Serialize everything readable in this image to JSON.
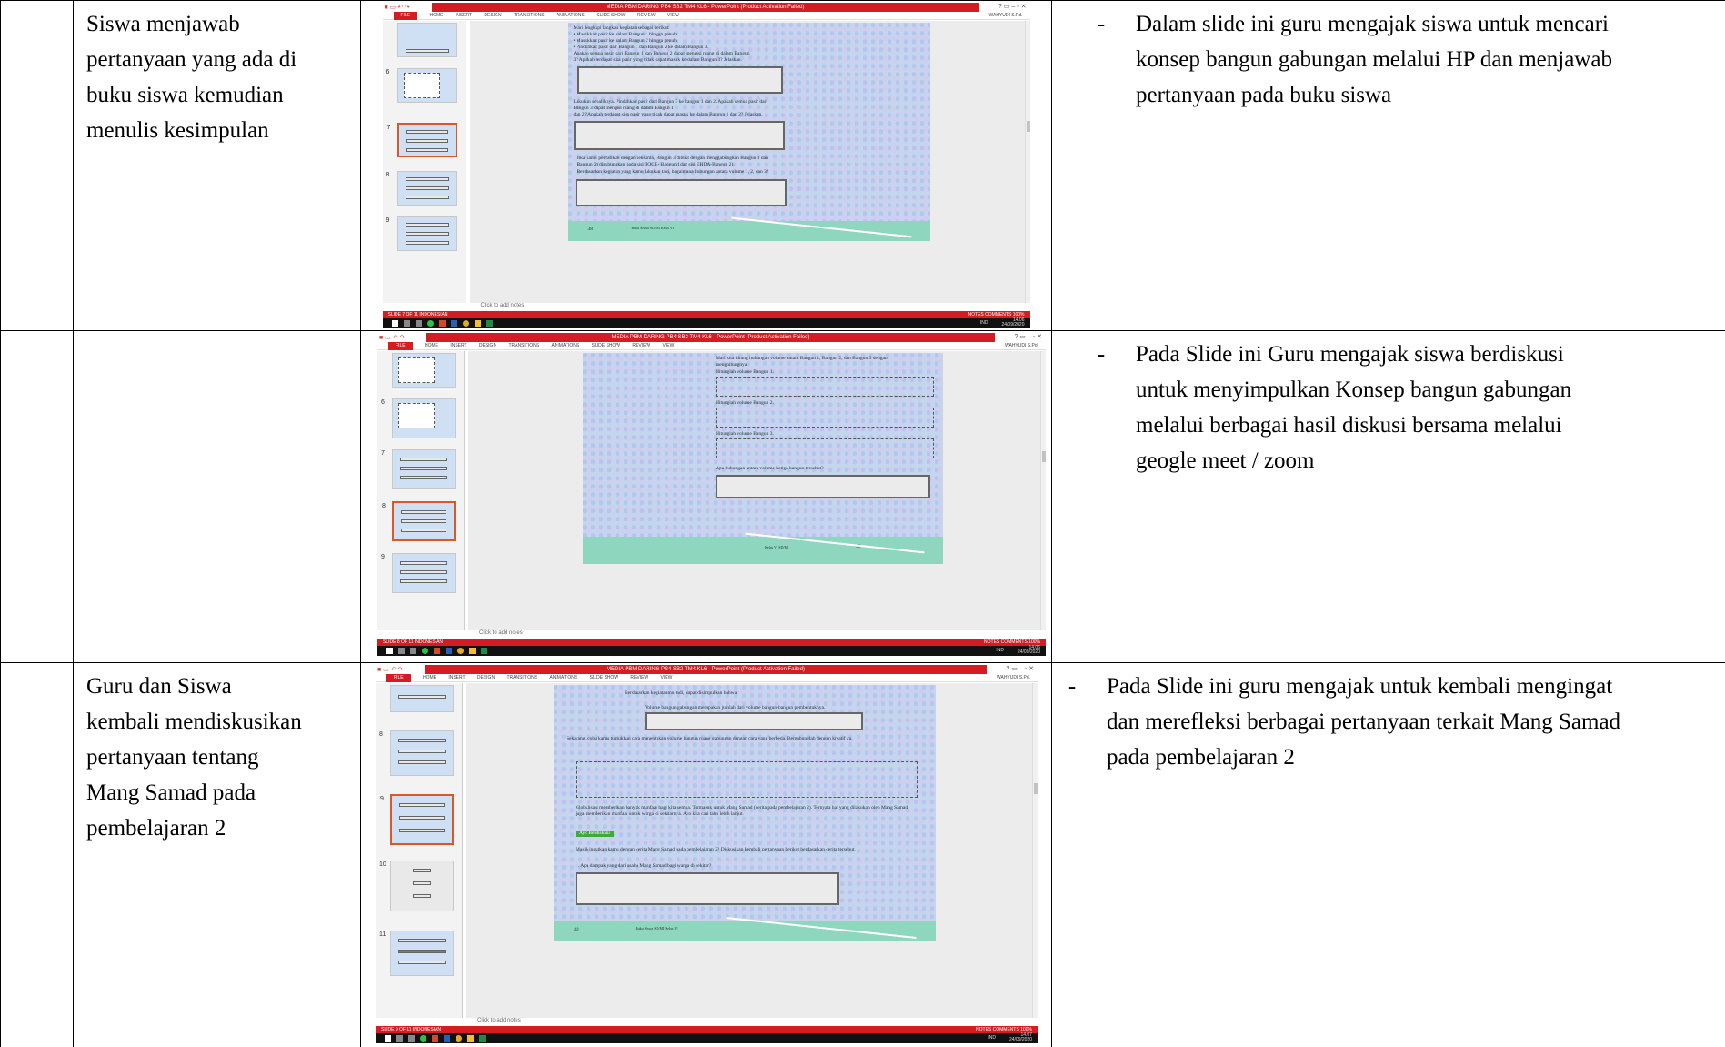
{
  "rows": [
    {
      "activity": "Siswa menjawab pertanyaan yang ada di buku siswa kemudian menulis kesimpulan",
      "activity_lines": [
        "Siswa menjawab",
        "pertanyaan yang ada di",
        "buku siswa kemudian",
        "menulis kesimpulan"
      ],
      "dash": "-",
      "desc_lines": [
        "Dalam slide ini guru mengajak siswa untuk mencari",
        "konsep bangun gabungan melalui HP dan menjawab",
        "pertanyaan pada buku siswa"
      ],
      "shot": {
        "title": "MEDIA PBM DARING PB4 SB2 TM4 KL6 - PowerPoint (Product Activation Failed)",
        "user": "WAHYUDI S.Pd.",
        "tabs": [
          "HOME",
          "INSERT",
          "DESIGN",
          "TRANSITIONS",
          "ANIMATIONS",
          "SLIDE SHOW",
          "REVIEW",
          "VIEW"
        ],
        "file_tab": "FILE",
        "thumb_numbers": [
          "6",
          "7",
          "8",
          "9"
        ],
        "slide_lines": [
          "Mari lengkapi langkah kegiatan sebagai berikut:",
          "• Masukkan pasir ke dalam Bangun 1 hingga penuh.",
          "• Masukkan pasir ke dalam Bangun 2 hingga penuh.",
          "• Pindahkan pasir dari Bangun 1 dan Bangun 2 ke dalam Bangun 3.",
          "Apakah semua pasir dari Bangun 1 dan Bangun 2 dapat mengisi ruang di dalam Bangun",
          "3? Apakah terdapat sisa pasir yang tidak dapat masuk ke dalam Bangun 3? Jelaskan."
        ],
        "slide_lines_2": [
          "Lakukan sebaliknya. Pindahkan pasir dari Bangun 3 ke bangun 1 dan 2. Apakah semua pasir dari",
          "Bangun 3 dapat mengisi ruang di dalam Bangun 1",
          "dan 2? Apakah terdapat sisa pasir yang tidak dapat masuk ke dalam Bangun 1 dan 2? Jelaskan."
        ],
        "slide_lines_3": [
          "Jika kamu perhatikan dengan seksama, Bangun 3 dibuat dengan menggabungkan Bangun 1 dan",
          "Bangun 2 (digabungkan pada sisi PQCB- Bangun 1dan sisi EHDA-Bangun 2).",
          "Berdasarkan kegiatan yang kamu lakukan tadi, bagaimana hubungan antara volume 1, 2, dan 3?"
        ],
        "band_num": "38",
        "band_text": "Buku Siswa SD/MI Kelas VI",
        "notes": "Click to add notes",
        "status_left": "SLIDE 7 OF 11   INDONESIAN",
        "status_right": "NOTES   COMMENTS   100%",
        "time": "14.06",
        "date": "24/09/2020",
        "lang": "IND"
      }
    },
    {
      "activity_lines": [],
      "dash": "-",
      "desc_lines": [
        "Pada Slide ini Guru mengajak siswa berdiskusi",
        "untuk  menyimpulkan Konsep bangun gabungan",
        "melalui berbagai hasil diskusi bersama melalui",
        "geogle meet / zoom"
      ],
      "shot": {
        "title": "MEDIA PBM DARING PB4 SB2 TM4 KL6 - PowerPoint (Product Activation Failed)",
        "user": "WAHYUDI S.Pd.",
        "tabs": [
          "HOME",
          "INSERT",
          "DESIGN",
          "TRANSITIONS",
          "ANIMATIONS",
          "SLIDE SHOW",
          "REVIEW",
          "VIEW"
        ],
        "file_tab": "FILE",
        "thumb_numbers": [
          "6",
          "7",
          "8",
          "9"
        ],
        "slide_lines": [
          "Mari kita hitung hubungan volume antara Bangun 1, Bangun 2, dan Bangun 3 dengan",
          "menghitungnya.",
          "Hitunglah volume Bangun 1."
        ],
        "q2": "Hitunglah volume Bangun 2.",
        "q3": "Hitunglah volume Bangun 3.",
        "q4": "Apa hubungan antara volume ketiga bangun tersebut?",
        "band_text": "Kelas VI SD/MI",
        "band_num": "39",
        "notes": "Click to add notes",
        "status_left": "SLIDE 8 OF 11   INDONESIAN",
        "status_right": "NOTES   COMMENTS   100%",
        "time": "14.06",
        "date": "24/09/2020",
        "lang": "IND"
      }
    },
    {
      "activity_lines": [
        "Guru dan Siswa",
        "kembali mendiskusikan",
        "pertanyaan tentang",
        "Mang Samad pada",
        "pembelajaran 2"
      ],
      "dash": "-",
      "desc_lines": [
        "Pada Slide ini guru mengajak untuk kembali mengingat",
        "dan merefleksi berbagai pertanyaan terkait Mang Samad",
        "pada pembelajaran 2"
      ],
      "shot": {
        "title": "MEDIA PBM DARING PB4 SB2 TM4 KL6 - PowerPoint (Product Activation Failed)",
        "user": "WAHYUDI S.Pd.",
        "tabs": [
          "HOME",
          "INSERT",
          "DESIGN",
          "TRANSITIONS",
          "ANIMATIONS",
          "SLIDE SHOW",
          "REVIEW",
          "VIEW"
        ],
        "file_tab": "FILE",
        "thumb_numbers": [
          "8",
          "9",
          "10",
          "11"
        ],
        "slide_lines": [
          "Berdasarkan kegiatanmu tadi, dapat disimpulkan bahwa:",
          "Volume bangun gabungan merupakan jumlah dari volume bangun-bangun pembentuknya."
        ],
        "q2": "Sekarang, coba kamu tunjukkan cara menentukan volume bangun ruang gabungan dengan cara yang berbeda. Bergabunglah dengan kreatif ya.",
        "q3": "Globalisasi memberikan banyak manfaat bagi kita semua. Termasuk untuk Mang Samad (cerita pada pembelajaran 2). Ternyata hal yang dilakukan oleh Mang Samad juga memberikan manfaat untuk warga di sekitarnya. Ayo kita cari tahu lebih lanjut.",
        "badge": "Ayo Berdiskusi",
        "q4": "Masih ingatkan kamu dengan cerita Mang Samad pada pembelajaran 2? Diskusikan kembali pertanyaan berikut berdasarkan cerita tersebut.",
        "q5": "1. Apa dampak yang dari usaha Mang Samad bagi warga di sekitar?",
        "band_num": "40",
        "band_text": "Buku Siswa SD/MI Kelas VI",
        "notes": "Click to add notes",
        "status_left": "SLIDE 9 OF 11   INDONESIAN",
        "status_right": "NOTES   COMMENTS   100%",
        "time": "14.07",
        "date": "24/09/2020",
        "lang": "IND"
      }
    }
  ]
}
